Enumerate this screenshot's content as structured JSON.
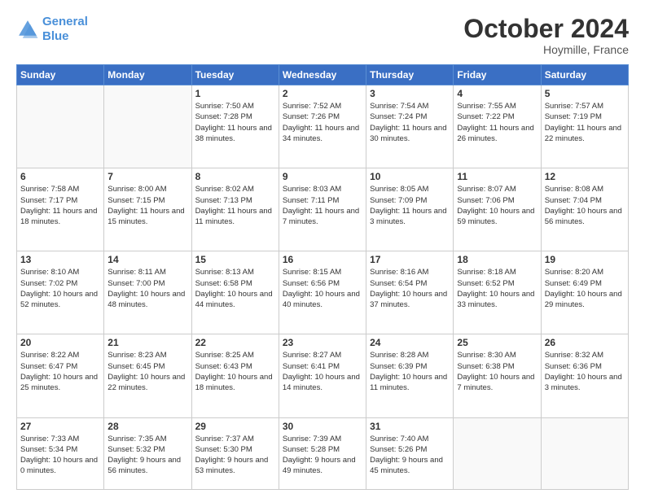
{
  "logo": {
    "line1": "General",
    "line2": "Blue"
  },
  "title": "October 2024",
  "subtitle": "Hoymille, France",
  "days_header": [
    "Sunday",
    "Monday",
    "Tuesday",
    "Wednesday",
    "Thursday",
    "Friday",
    "Saturday"
  ],
  "weeks": [
    [
      {
        "day": "",
        "info": ""
      },
      {
        "day": "",
        "info": ""
      },
      {
        "day": "1",
        "info": "Sunrise: 7:50 AM\nSunset: 7:28 PM\nDaylight: 11 hours and 38 minutes."
      },
      {
        "day": "2",
        "info": "Sunrise: 7:52 AM\nSunset: 7:26 PM\nDaylight: 11 hours and 34 minutes."
      },
      {
        "day": "3",
        "info": "Sunrise: 7:54 AM\nSunset: 7:24 PM\nDaylight: 11 hours and 30 minutes."
      },
      {
        "day": "4",
        "info": "Sunrise: 7:55 AM\nSunset: 7:22 PM\nDaylight: 11 hours and 26 minutes."
      },
      {
        "day": "5",
        "info": "Sunrise: 7:57 AM\nSunset: 7:19 PM\nDaylight: 11 hours and 22 minutes."
      }
    ],
    [
      {
        "day": "6",
        "info": "Sunrise: 7:58 AM\nSunset: 7:17 PM\nDaylight: 11 hours and 18 minutes."
      },
      {
        "day": "7",
        "info": "Sunrise: 8:00 AM\nSunset: 7:15 PM\nDaylight: 11 hours and 15 minutes."
      },
      {
        "day": "8",
        "info": "Sunrise: 8:02 AM\nSunset: 7:13 PM\nDaylight: 11 hours and 11 minutes."
      },
      {
        "day": "9",
        "info": "Sunrise: 8:03 AM\nSunset: 7:11 PM\nDaylight: 11 hours and 7 minutes."
      },
      {
        "day": "10",
        "info": "Sunrise: 8:05 AM\nSunset: 7:09 PM\nDaylight: 11 hours and 3 minutes."
      },
      {
        "day": "11",
        "info": "Sunrise: 8:07 AM\nSunset: 7:06 PM\nDaylight: 10 hours and 59 minutes."
      },
      {
        "day": "12",
        "info": "Sunrise: 8:08 AM\nSunset: 7:04 PM\nDaylight: 10 hours and 56 minutes."
      }
    ],
    [
      {
        "day": "13",
        "info": "Sunrise: 8:10 AM\nSunset: 7:02 PM\nDaylight: 10 hours and 52 minutes."
      },
      {
        "day": "14",
        "info": "Sunrise: 8:11 AM\nSunset: 7:00 PM\nDaylight: 10 hours and 48 minutes."
      },
      {
        "day": "15",
        "info": "Sunrise: 8:13 AM\nSunset: 6:58 PM\nDaylight: 10 hours and 44 minutes."
      },
      {
        "day": "16",
        "info": "Sunrise: 8:15 AM\nSunset: 6:56 PM\nDaylight: 10 hours and 40 minutes."
      },
      {
        "day": "17",
        "info": "Sunrise: 8:16 AM\nSunset: 6:54 PM\nDaylight: 10 hours and 37 minutes."
      },
      {
        "day": "18",
        "info": "Sunrise: 8:18 AM\nSunset: 6:52 PM\nDaylight: 10 hours and 33 minutes."
      },
      {
        "day": "19",
        "info": "Sunrise: 8:20 AM\nSunset: 6:49 PM\nDaylight: 10 hours and 29 minutes."
      }
    ],
    [
      {
        "day": "20",
        "info": "Sunrise: 8:22 AM\nSunset: 6:47 PM\nDaylight: 10 hours and 25 minutes."
      },
      {
        "day": "21",
        "info": "Sunrise: 8:23 AM\nSunset: 6:45 PM\nDaylight: 10 hours and 22 minutes."
      },
      {
        "day": "22",
        "info": "Sunrise: 8:25 AM\nSunset: 6:43 PM\nDaylight: 10 hours and 18 minutes."
      },
      {
        "day": "23",
        "info": "Sunrise: 8:27 AM\nSunset: 6:41 PM\nDaylight: 10 hours and 14 minutes."
      },
      {
        "day": "24",
        "info": "Sunrise: 8:28 AM\nSunset: 6:39 PM\nDaylight: 10 hours and 11 minutes."
      },
      {
        "day": "25",
        "info": "Sunrise: 8:30 AM\nSunset: 6:38 PM\nDaylight: 10 hours and 7 minutes."
      },
      {
        "day": "26",
        "info": "Sunrise: 8:32 AM\nSunset: 6:36 PM\nDaylight: 10 hours and 3 minutes."
      }
    ],
    [
      {
        "day": "27",
        "info": "Sunrise: 7:33 AM\nSunset: 5:34 PM\nDaylight: 10 hours and 0 minutes."
      },
      {
        "day": "28",
        "info": "Sunrise: 7:35 AM\nSunset: 5:32 PM\nDaylight: 9 hours and 56 minutes."
      },
      {
        "day": "29",
        "info": "Sunrise: 7:37 AM\nSunset: 5:30 PM\nDaylight: 9 hours and 53 minutes."
      },
      {
        "day": "30",
        "info": "Sunrise: 7:39 AM\nSunset: 5:28 PM\nDaylight: 9 hours and 49 minutes."
      },
      {
        "day": "31",
        "info": "Sunrise: 7:40 AM\nSunset: 5:26 PM\nDaylight: 9 hours and 45 minutes."
      },
      {
        "day": "",
        "info": ""
      },
      {
        "day": "",
        "info": ""
      }
    ]
  ]
}
